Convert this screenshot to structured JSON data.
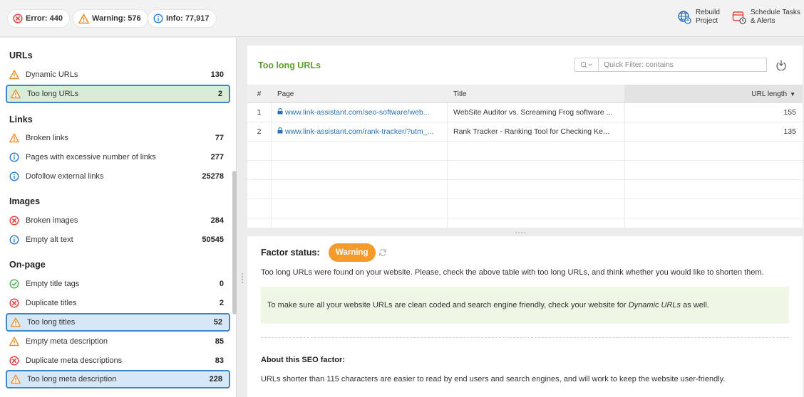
{
  "topbar": {
    "error_label": "Error: 440",
    "warning_label": "Warning: 576",
    "info_label": "Info: 77,917",
    "rebuild_line1": "Rebuild",
    "rebuild_line2": "Project",
    "schedule_line1": "Schedule Tasks",
    "schedule_line2": "& Alerts"
  },
  "colors": {
    "error": "#e0443e",
    "warning": "#f08a24",
    "info": "#2b7cd3",
    "ok": "#4caf50",
    "title_green": "#5a9e2f",
    "badge_orange": "#f49b2a"
  },
  "sidebar": {
    "groups": [
      {
        "title": "URLs",
        "items": [
          {
            "label": "Dynamic URLs",
            "count": "130",
            "status": "warning"
          },
          {
            "label": "Too long URLs",
            "count": "2",
            "status": "warning",
            "selected": true
          }
        ]
      },
      {
        "title": "Links",
        "items": [
          {
            "label": "Broken links",
            "count": "77",
            "status": "warning"
          },
          {
            "label": "Pages with excessive number of links",
            "count": "277",
            "status": "info"
          },
          {
            "label": "Dofollow external links",
            "count": "25278",
            "status": "info"
          }
        ]
      },
      {
        "title": "Images",
        "items": [
          {
            "label": "Broken images",
            "count": "284",
            "status": "error"
          },
          {
            "label": "Empty alt text",
            "count": "50545",
            "status": "info"
          }
        ]
      },
      {
        "title": "On-page",
        "items": [
          {
            "label": "Empty title tags",
            "count": "0",
            "status": "ok"
          },
          {
            "label": "Duplicate titles",
            "count": "2",
            "status": "error"
          },
          {
            "label": "Too long titles",
            "count": "52",
            "status": "warning",
            "highlighted": true
          },
          {
            "label": "Empty meta description",
            "count": "85",
            "status": "warning"
          },
          {
            "label": "Duplicate meta descriptions",
            "count": "83",
            "status": "error"
          },
          {
            "label": "Too long meta description",
            "count": "228",
            "status": "warning",
            "highlighted": true
          }
        ]
      }
    ]
  },
  "main": {
    "title": "Too long URLs",
    "filter_placeholder": "Quick Filter: contains",
    "columns": {
      "num": "#",
      "page": "Page",
      "title": "Title",
      "url_length": "URL length"
    },
    "rows": [
      {
        "num": "1",
        "page": "www.link-assistant.com/seo-software/web...",
        "title": "WebSite Auditor vs. Screaming Frog software ...",
        "url_length": "155"
      },
      {
        "num": "2",
        "page": "www.link-assistant.com/rank-tracker/?utm_...",
        "title": "Rank Tracker - Ranking Tool for Checking Ke...",
        "url_length": "135"
      }
    ]
  },
  "factor": {
    "label": "Factor status:",
    "status": "Warning",
    "description": "Too long URLs were found on your website. Please, check the above table with too long URLs, and think whether you would like to shorten them.",
    "tip_prefix": "To make sure all your website URLs are clean coded and search engine friendly, check your website for ",
    "tip_link": "Dynamic URLs",
    "tip_suffix": " as well.",
    "about_title": "About this SEO factor:",
    "about_text": "URLs shorter than 115 characters are easier to read by end users and search engines, and will work to keep the website user-friendly."
  }
}
